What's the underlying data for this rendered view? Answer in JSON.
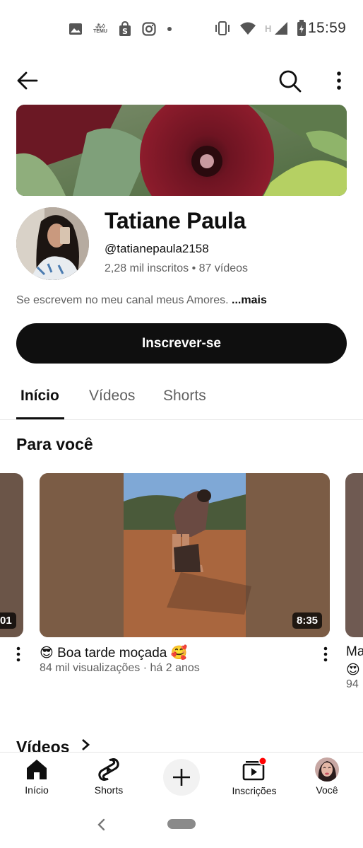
{
  "status_bar": {
    "time": "15:59",
    "icons_left": [
      "image-icon",
      "temu-icon",
      "shopee-icon",
      "instagram-icon",
      "dot-icon"
    ],
    "temu_label": "TEMU",
    "icons_right": [
      "vibrate-icon",
      "wifi-icon",
      "h-network-icon",
      "signal-icon",
      "battery-icon"
    ],
    "network_label": "H"
  },
  "channel": {
    "name": "Tatiane Paula",
    "handle": "@tatianepaula2158",
    "stats": "2,28 mil inscritos • 87 vídeos",
    "description": "Se escrevem no meu canal meus Amores. ",
    "more_label": "...mais",
    "subscribe_label": "Inscrever-se"
  },
  "tabs": [
    {
      "label": "Início",
      "active": true
    },
    {
      "label": "Vídeos",
      "active": false
    },
    {
      "label": "Shorts",
      "active": false
    }
  ],
  "section_for_you": "Para você",
  "carousel": {
    "left_partial_duration": "01",
    "main": {
      "duration": "8:35",
      "title": "😎 Boa tarde moçada 🥰",
      "meta": "84 mil visualizações · há 2 anos"
    },
    "right_partial": {
      "title": "Ma",
      "emoji": "😍",
      "meta": "94"
    }
  },
  "section_videos": "Vídeos",
  "bottom_nav": [
    {
      "label": "Início",
      "icon": "home-icon"
    },
    {
      "label": "Shorts",
      "icon": "shorts-icon"
    },
    {
      "label": "",
      "icon": "create-plus-icon"
    },
    {
      "label": "Inscrições",
      "icon": "subscriptions-icon"
    },
    {
      "label": "Você",
      "icon": "avatar"
    }
  ],
  "colors": {
    "text": "#0f0f0f",
    "secondary_text": "#606060",
    "subscribe_bg": "#0f0f0f",
    "notification_dot": "#ff0000"
  }
}
